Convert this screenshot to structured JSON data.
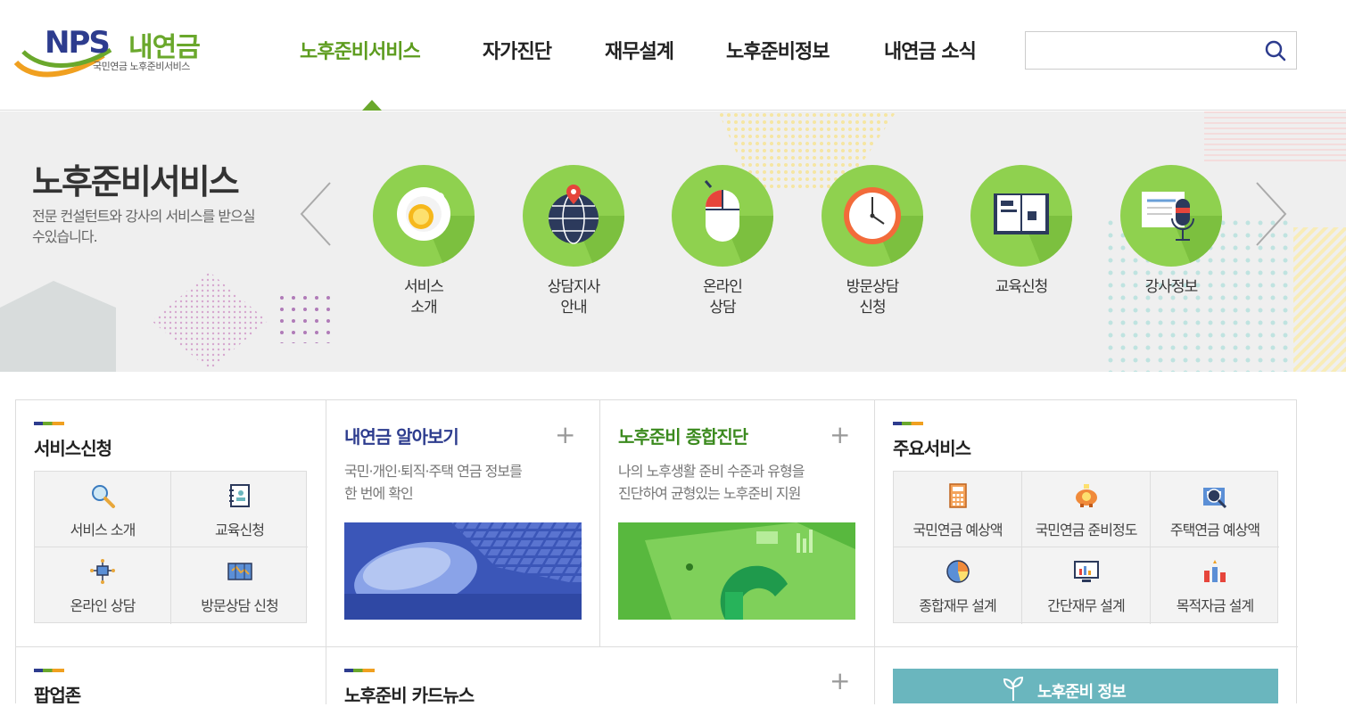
{
  "logo": {
    "brand": "NPS",
    "name": "내연금",
    "subtitle": "국민연금 노후준비서비스"
  },
  "nav": {
    "items": [
      {
        "label": "노후준비서비스",
        "active": true
      },
      {
        "label": "자가진단",
        "active": false
      },
      {
        "label": "재무설계",
        "active": false
      },
      {
        "label": "노후준비정보",
        "active": false
      },
      {
        "label": "내연금 소식",
        "active": false
      }
    ]
  },
  "search": {
    "value": "",
    "placeholder": ""
  },
  "banner": {
    "title": "노후준비서비스",
    "description": "전문 컨설턴트와 강사의 서비스를 받으실 수있습니다.",
    "services": [
      {
        "label": "서비스\n소개",
        "icon": "coffee-cup-icon"
      },
      {
        "label": "상담지사\n안내",
        "icon": "globe-pin-icon"
      },
      {
        "label": "온라인\n상담",
        "icon": "mouse-icon"
      },
      {
        "label": "방문상담\n신청",
        "icon": "clock-icon"
      },
      {
        "label": "교육신청",
        "icon": "open-book-icon"
      },
      {
        "label": "강사정보",
        "icon": "microphone-icon"
      }
    ]
  },
  "sections": {
    "service_apply": {
      "title": "서비스신청",
      "tiles": [
        {
          "label": "서비스 소개",
          "icon": "magnifier-icon"
        },
        {
          "label": "교육신청",
          "icon": "contact-book-icon"
        },
        {
          "label": "온라인 상담",
          "icon": "network-icon"
        },
        {
          "label": "방문상담 신청",
          "icon": "map-icon"
        }
      ]
    },
    "my_pension": {
      "title": "내연금 알아보기",
      "plus": "+",
      "description": "국민·개인·퇴직·주택 연금 정보를\n한 번에 확인"
    },
    "diagnosis": {
      "title": "노후준비 종합진단",
      "plus": "+",
      "description": "나의 노후생활 준비 수준과 유형을\n진단하여 균형있는 노후준비 지원"
    },
    "main_services": {
      "title": "주요서비스",
      "tiles": [
        {
          "label": "국민연금 예상액",
          "icon": "calculator-icon"
        },
        {
          "label": "국민연금 준비정도",
          "icon": "piggy-bank-icon"
        },
        {
          "label": "주택연금 예상액",
          "icon": "house-search-icon"
        },
        {
          "label": "종합재무 설계",
          "icon": "pie-chart-icon"
        },
        {
          "label": "간단재무 설계",
          "icon": "monitor-chart-icon"
        },
        {
          "label": "목적자금 설계",
          "icon": "bars-icon"
        }
      ]
    },
    "popup_zone": {
      "title": "팝업존"
    },
    "card_news": {
      "title": "노후준비 카드뉴스",
      "plus": "+"
    },
    "info_button": {
      "label": "노후준비 정보"
    }
  },
  "colors": {
    "brand_navy": "#2d3c8e",
    "brand_green": "#6aa82c",
    "circle_green": "#8fd14f",
    "info_teal": "#6ab6be"
  }
}
